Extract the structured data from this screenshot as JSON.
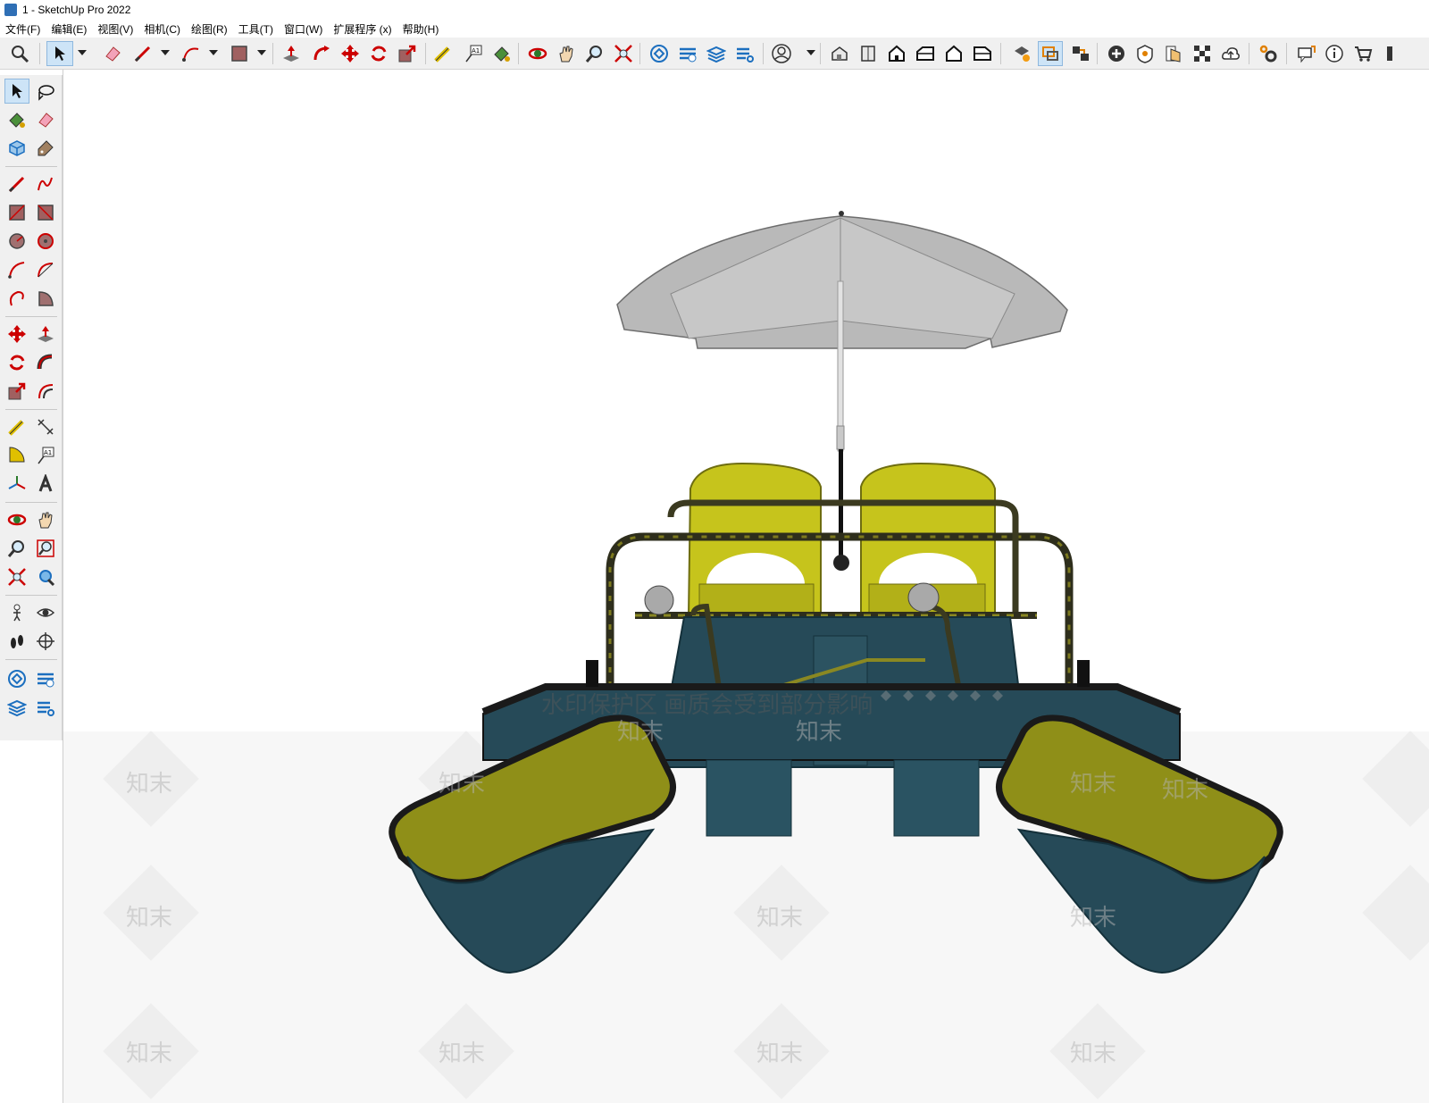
{
  "window": {
    "title": "1 - SketchUp Pro 2022"
  },
  "menu": [
    {
      "label": "文件(F)"
    },
    {
      "label": "编辑(E)"
    },
    {
      "label": "视图(V)"
    },
    {
      "label": "相机(C)"
    },
    {
      "label": "绘图(R)"
    },
    {
      "label": "工具(T)"
    },
    {
      "label": "窗口(W)"
    },
    {
      "label": "扩展程序 (x)"
    },
    {
      "label": "帮助(H)"
    }
  ],
  "toolbar": {
    "components_label": "A1"
  },
  "left_toolbar": {
    "text_tool_label": "A1"
  },
  "viewport": {
    "watermark_text": "水印保护区  画质会受到部分影响",
    "watermark_brand": "知末",
    "model": "pedal-boat-with-umbrella",
    "colors": {
      "umbrella": "#b9b9b9",
      "seats": "#c6c41c",
      "hull": "#264a58",
      "frame": "#2a2a22",
      "floats_top": "#8f8f18"
    }
  }
}
